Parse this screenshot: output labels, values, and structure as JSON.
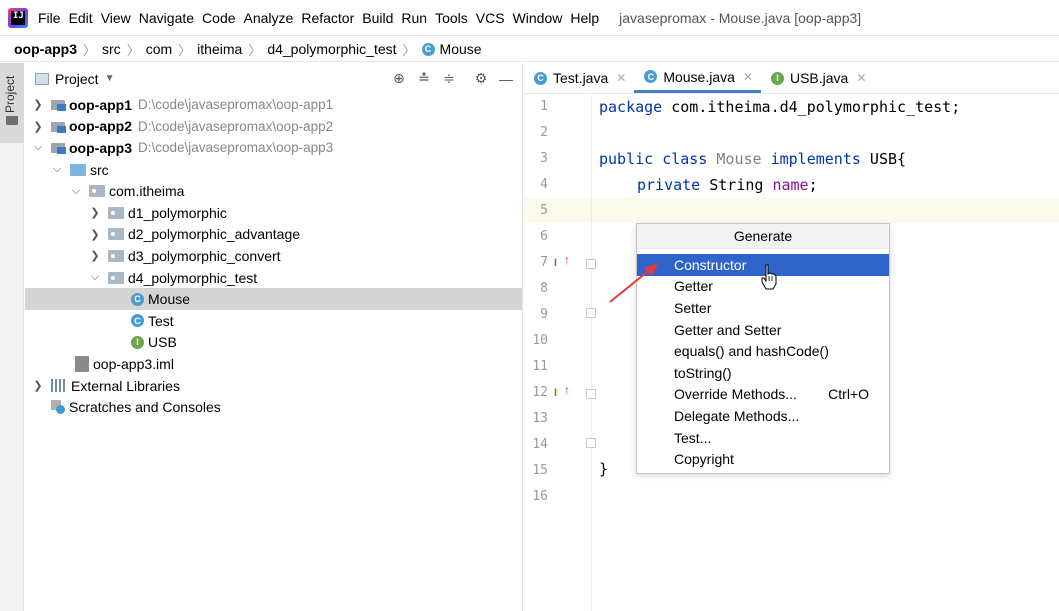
{
  "menubar": {
    "items": [
      "File",
      "Edit",
      "View",
      "Navigate",
      "Code",
      "Analyze",
      "Refactor",
      "Build",
      "Run",
      "Tools",
      "VCS",
      "Window",
      "Help"
    ],
    "window_title": "javasepromax - Mouse.java [oop-app3]"
  },
  "breadcrumb": [
    "oop-app3",
    "src",
    "com",
    "itheima",
    "d4_polymorphic_test",
    "Mouse"
  ],
  "stripe": {
    "label": "Project"
  },
  "project_panel": {
    "title": "Project",
    "tree": [
      {
        "label": "oop-app1",
        "path": "D:\\code\\javasepromax\\oop-app1"
      },
      {
        "label": "oop-app2",
        "path": "D:\\code\\javasepromax\\oop-app2"
      },
      {
        "label": "oop-app3",
        "path": "D:\\code\\javasepromax\\oop-app3"
      },
      {
        "label": "src"
      },
      {
        "label": "com.itheima"
      },
      {
        "label": "d1_polymorphic"
      },
      {
        "label": "d2_polymorphic_advantage"
      },
      {
        "label": "d3_polymorphic_convert"
      },
      {
        "label": "d4_polymorphic_test"
      },
      {
        "label": "Mouse"
      },
      {
        "label": "Test"
      },
      {
        "label": "USB"
      },
      {
        "label": "oop-app3.iml"
      },
      {
        "label": "External Libraries"
      },
      {
        "label": "Scratches and Consoles"
      }
    ]
  },
  "editor_tabs": [
    {
      "label": "Test.java",
      "icon": "C",
      "active": false
    },
    {
      "label": "Mouse.java",
      "icon": "C",
      "active": true
    },
    {
      "label": "USB.java",
      "icon": "I",
      "active": false
    }
  ],
  "editor": {
    "line_numbers": [
      "1",
      "2",
      "3",
      "4",
      "5",
      "6",
      "7",
      "8",
      "9",
      "10",
      "11",
      "12",
      "13",
      "14",
      "15",
      "16"
    ],
    "code": {
      "l1_kw": "package",
      "l1_rest": " com.itheima.d4_polymorphic_test;",
      "l3_kw1": "public class",
      "l3_cls": " Mouse ",
      "l3_kw2": "implements",
      "l3_rest": " USB{",
      "l4_kw": "private",
      "l4_type": " String ",
      "l4_fld": "name",
      "l4_end": ";",
      "l15": "}"
    },
    "gutter_marks": [
      "I",
      "I"
    ]
  },
  "generate_popup": {
    "title": "Generate",
    "items": [
      {
        "label": "Constructor",
        "shortcut": ""
      },
      {
        "label": "Getter",
        "shortcut": ""
      },
      {
        "label": "Setter",
        "shortcut": ""
      },
      {
        "label": "Getter and Setter",
        "shortcut": ""
      },
      {
        "label": "equals() and hashCode()",
        "shortcut": ""
      },
      {
        "label": "toString()",
        "shortcut": ""
      },
      {
        "label": "Override Methods...",
        "shortcut": "Ctrl+O"
      },
      {
        "label": "Delegate Methods...",
        "shortcut": ""
      },
      {
        "label": "Test...",
        "shortcut": ""
      },
      {
        "label": "Copyright",
        "shortcut": ""
      }
    ],
    "selected_index": 0
  },
  "colors": {
    "selection": "#2f65ca",
    "keyword": "#0033b3",
    "field": "#871094",
    "annotation_arrow": "#e53935",
    "tab_underline": "#4083c9"
  }
}
